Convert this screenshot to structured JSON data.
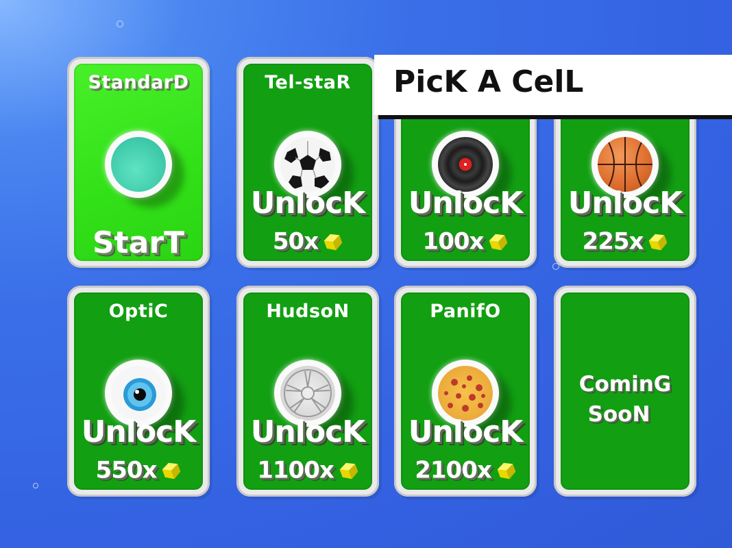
{
  "banner": {
    "title": "PicK A CelL"
  },
  "cells": [
    {
      "id": "standard",
      "name": "StandarD",
      "action": "StarT",
      "icon": "teal-disc-icon",
      "selected": true
    },
    {
      "id": "telstar",
      "name": "Tel-staR",
      "action": "UnlocK",
      "price": "50x",
      "icon": "soccer-ball-icon"
    },
    {
      "id": "vinyl",
      "name": "",
      "action": "UnlocK",
      "price": "100x",
      "icon": "vinyl-record-icon"
    },
    {
      "id": "basketball",
      "name": "",
      "action": "UnlocK",
      "price": "225x",
      "icon": "basketball-icon"
    },
    {
      "id": "optic",
      "name": "OptiC",
      "action": "UnlocK",
      "price": "550x",
      "icon": "eyeball-icon"
    },
    {
      "id": "hudson",
      "name": "HudsoN",
      "action": "UnlocK",
      "price": "1100x",
      "icon": "wheel-rim-icon"
    },
    {
      "id": "panifo",
      "name": "PanifO",
      "action": "UnlocK",
      "price": "2100x",
      "icon": "pizza-icon"
    },
    {
      "id": "coming",
      "line1": "CominG",
      "line2": "SooN"
    }
  ],
  "colors": {
    "card_green": "#129f12",
    "selected_green": "#3fe620",
    "cube_yellow": "#f5e612",
    "background_blue": "#3462e2"
  }
}
